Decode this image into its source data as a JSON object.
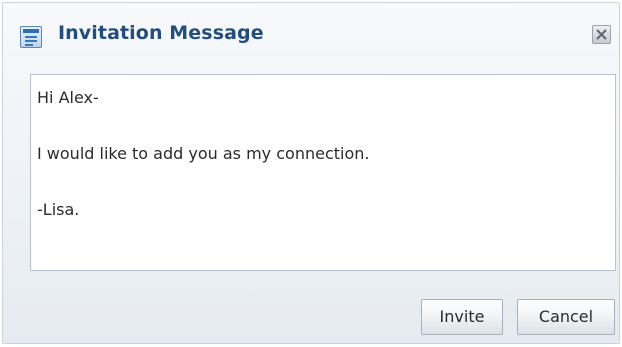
{
  "dialog": {
    "title": "Invitation Message",
    "title_icon": "document-icon",
    "close_icon": "close-icon"
  },
  "message": {
    "value": "Hi Alex-\n\nI would like to add you as my connection.\n\n-Lisa."
  },
  "buttons": {
    "invite_label": "Invite",
    "cancel_label": "Cancel"
  },
  "colors": {
    "title_text": "#224d7e",
    "dialog_background": "#eef2f6",
    "message_background": "#ffffff"
  }
}
